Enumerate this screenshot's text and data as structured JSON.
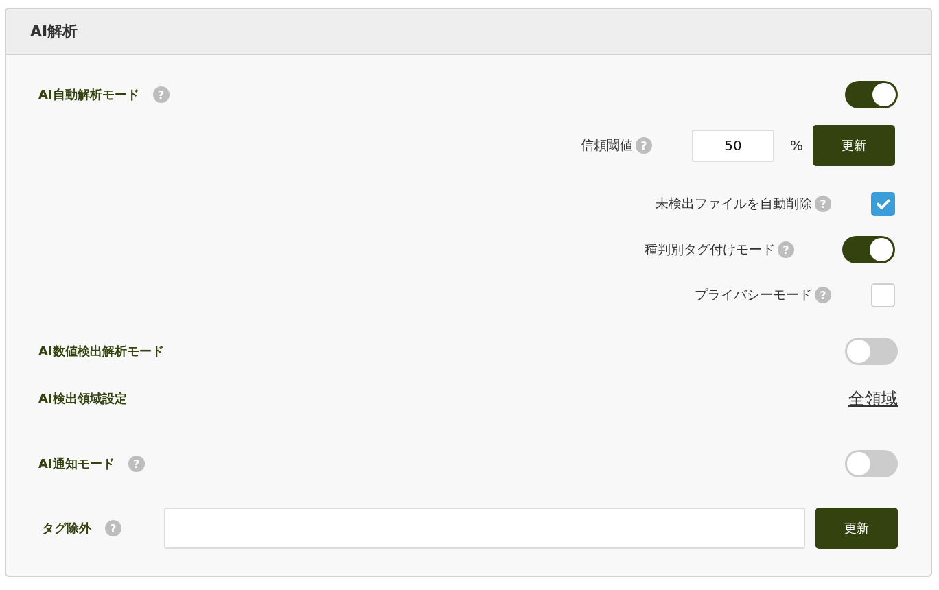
{
  "panel": {
    "title": "AI解析"
  },
  "settings": [
    {
      "kind": "toggle",
      "label": "AI自動解析モード",
      "help": "?",
      "on": true,
      "sub": [
        {
          "kind": "threshold",
          "label": "信頼閾値",
          "help": "?",
          "value": "50",
          "unit": "%",
          "button": "更新"
        },
        {
          "kind": "checkbox",
          "label": "未検出ファイルを自動削除",
          "help": "?",
          "checked": true
        },
        {
          "kind": "toggle",
          "label": "種判別タグ付けモード",
          "help": "?",
          "on": true
        },
        {
          "kind": "checkbox",
          "label": "プライバシーモード",
          "help": "?",
          "checked": false
        }
      ]
    },
    {
      "kind": "toggle",
      "label": "AI数値検出解析モード",
      "on": false
    },
    {
      "kind": "link",
      "label": "AI検出領域設定",
      "link": "全領域"
    },
    {
      "kind": "toggle",
      "label": "AI通知モード",
      "help": "?",
      "on": false
    },
    {
      "kind": "tag_input",
      "label": "タグ除外",
      "help": "?",
      "button": "更新"
    }
  ]
}
